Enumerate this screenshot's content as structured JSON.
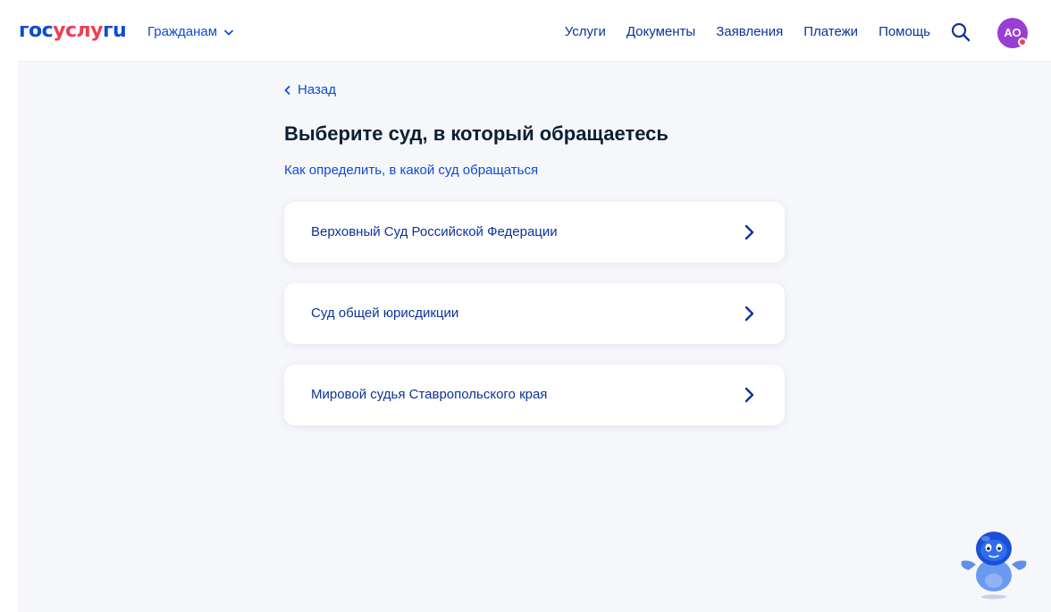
{
  "header": {
    "logo": {
      "part1": "гос",
      "part2": "услу",
      "part3": "гu"
    },
    "audience_label": "Гражданам",
    "nav": [
      "Услуги",
      "Документы",
      "Заявления",
      "Платежи",
      "Помощь"
    ],
    "avatar_initials": "АО"
  },
  "main": {
    "back_label": "Назад",
    "title": "Выберите суд, в который обращаетесь",
    "help_link": "Как определить, в какой суд обращаться",
    "options": [
      "Верховный Суд Российской Федерации",
      "Суд общей юрисдикции",
      "Мировой судья Ставропольского края"
    ]
  },
  "colors": {
    "brand_blue": "#0d4cd3",
    "brand_red": "#ee3f58",
    "link_blue": "#0b3399",
    "avatar": "#9b3dd3",
    "background": "#f5f7fb"
  },
  "icons": [
    "chevron-down-icon",
    "search-icon",
    "chevron-left-icon",
    "chevron-right-icon",
    "robot-assistant-icon"
  ]
}
